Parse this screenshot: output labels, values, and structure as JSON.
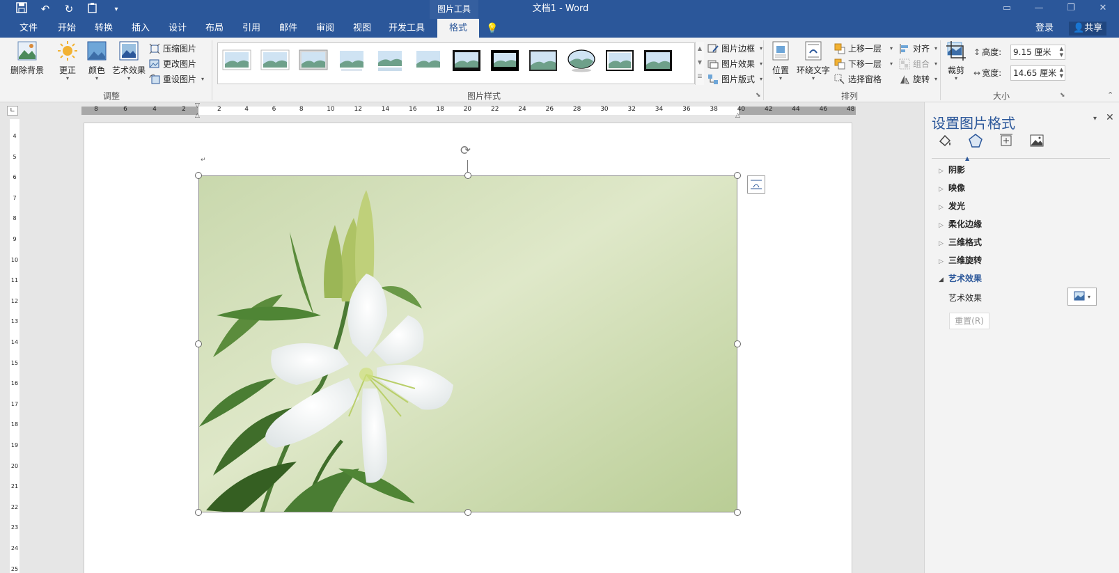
{
  "titlebar": {
    "context_tool": "图片工具",
    "document_title": "文档1 - Word"
  },
  "tabs": [
    {
      "label": "文件"
    },
    {
      "label": "开始"
    },
    {
      "label": "转换"
    },
    {
      "label": "插入"
    },
    {
      "label": "设计"
    },
    {
      "label": "布局"
    },
    {
      "label": "引用"
    },
    {
      "label": "邮件"
    },
    {
      "label": "审阅"
    },
    {
      "label": "视图"
    },
    {
      "label": "开发工具"
    },
    {
      "label": "格式"
    }
  ],
  "account": {
    "login": "登录",
    "share": "共享"
  },
  "ribbon": {
    "adjust": {
      "remove_bg": "删除背景",
      "corrections": "更正",
      "color": "颜色",
      "artistic": "艺术效果",
      "compress": "压缩图片",
      "change": "更改图片",
      "reset": "重设图片",
      "group_label": "调整"
    },
    "styles": {
      "border": "图片边框",
      "effects": "图片效果",
      "layout": "图片版式",
      "group_label": "图片样式"
    },
    "arrange": {
      "position": "位置",
      "wrap": "环绕文字",
      "forward": "上移一层",
      "backward": "下移一层",
      "selection_pane": "选择窗格",
      "align": "对齐",
      "group": "组合",
      "rotate": "旋转",
      "group_label": "排列"
    },
    "size": {
      "crop": "裁剪",
      "height_label": "高度:",
      "height_value": "9.15 厘米",
      "width_label": "宽度:",
      "width_value": "14.65 厘米",
      "group_label": "大小"
    }
  },
  "ruler": {
    "h_left": [
      "8",
      "6",
      "4",
      "2"
    ],
    "h_right": [
      "2",
      "4",
      "6",
      "8",
      "10",
      "12",
      "14",
      "16",
      "18",
      "20",
      "22",
      "24",
      "26",
      "28",
      "30",
      "32",
      "34",
      "36",
      "38",
      "40",
      "42",
      "44",
      "46",
      "48"
    ],
    "v": [
      "4",
      "5",
      "6",
      "7",
      "8",
      "9",
      "10",
      "11",
      "12",
      "13",
      "14",
      "15",
      "16",
      "17",
      "18",
      "19",
      "20",
      "21",
      "22",
      "23",
      "24",
      "25"
    ]
  },
  "document": {
    "paragraph_mark": "↵"
  },
  "pane": {
    "title": "设置图片格式",
    "sections": [
      "阴影",
      "映像",
      "发光",
      "柔化边缘",
      "三维格式",
      "三维旋转",
      "艺术效果"
    ],
    "artistic_label": "艺术效果",
    "reset_button": "重置(R)"
  },
  "colors": {
    "titlebar": "#2b579a",
    "ribbon": "#f3f3f3",
    "accent": "#2b579a"
  }
}
